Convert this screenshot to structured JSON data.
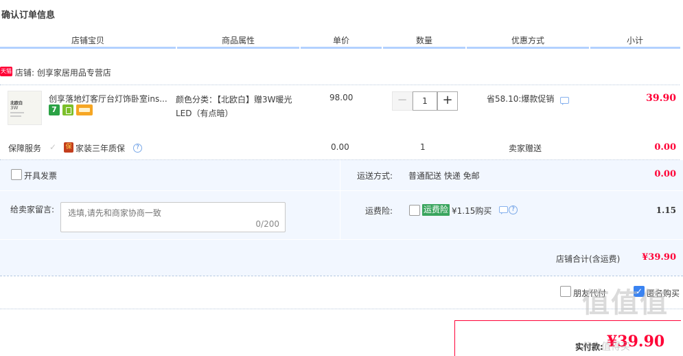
{
  "page_title": "确认订单信息",
  "columns": [
    "店铺宝贝",
    "商品属性",
    "单价",
    "数量",
    "优惠方式",
    "小计"
  ],
  "shop": {
    "badge": "天猫",
    "label": "店铺: 创享家居用品专营店"
  },
  "item": {
    "thumb_text_1": "北欧白",
    "thumb_text_2": "3W",
    "title": "创享落地灯客厅台灯饰卧室ins...",
    "tag_7": "7",
    "attr": "颜色分类：【北欧白】赠3W暖光LED（有点暗）",
    "price": "98.00",
    "qty": "1",
    "qty_minus": "−",
    "qty_plus": "+",
    "promo": "省58.10:爆款促销",
    "subtotal": "39.90"
  },
  "guarantee": {
    "label": "保障服务",
    "check": "✓",
    "icon": "保",
    "text": "家装三年质保",
    "help": "?",
    "price": "0.00",
    "qty": "1",
    "promo": "卖家赠送",
    "subtotal": "0.00"
  },
  "invoice": {
    "label": "开具发票"
  },
  "shipping": {
    "label": "运送方式:",
    "value": "普通配送 快递 免邮",
    "subtotal": "0.00"
  },
  "message": {
    "label": "给卖家留言:",
    "placeholder": "选填,请先和商家协商一致",
    "count": "0/200"
  },
  "insurance": {
    "label": "运费险:",
    "tag": "运费险",
    "text": "¥1.15购买",
    "help": "?",
    "value": "1.15"
  },
  "total": {
    "label": "店铺合计(含运费)",
    "value": "¥39.90"
  },
  "options": {
    "friend_pay": "朋友代付",
    "anonymous": "匿名购买",
    "anonymous_check": "✓"
  },
  "payment": {
    "label": "实付款:",
    "value": "¥39.90"
  },
  "watermark": "值值值",
  "watermark_sub": "什么值得买"
}
